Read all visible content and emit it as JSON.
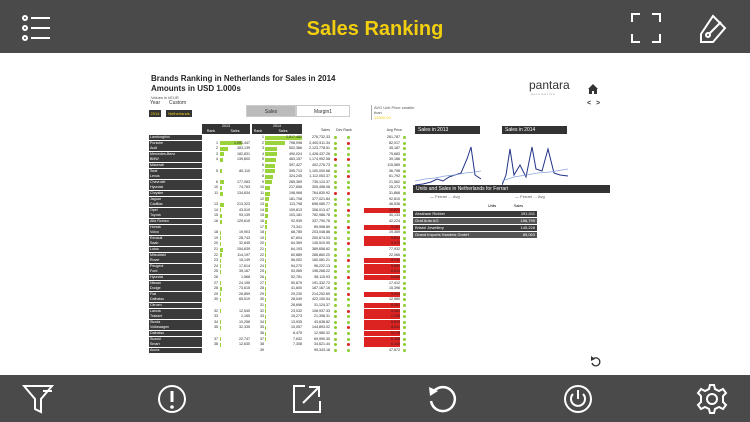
{
  "app": {
    "title": "Sales Ranking"
  },
  "toolbar": {
    "icons": [
      "list-icon",
      "fullscreen-icon",
      "tag-icon"
    ]
  },
  "bottom": {
    "icons": [
      "filter-icon",
      "alert-icon",
      "export-icon",
      "reload-icon",
      "power-icon",
      "settings-icon"
    ]
  },
  "report": {
    "title": "Brands Ranking in Netherlands for Sales in 2014",
    "subtitle": "Amounts in USD 1.000s",
    "note": "Values in kEUR",
    "logo": "pantara",
    "logo_sub": "automotive",
    "filter_year_label": "Year",
    "filter_year_value": "2014",
    "filter_custom_label": "Custom",
    "filter_custom_value": "Netherlands",
    "toggle_sales": "Sales",
    "toggle_margin": "Margin1",
    "filter_tag": "AVG Unit Price smaller than",
    "filter_tag_value": "13400.00",
    "nav_prev": "<",
    "nav_next": ">"
  },
  "table": {
    "group_2013": "2013",
    "group_2014": "2014",
    "col_rank": "Rank",
    "col_sales": "Sales",
    "col_sales_total": "Sales",
    "col_dev_rank": "Dev Rank",
    "col_avg_price": "Avg Price",
    "rows": [
      {
        "brand": "Lamborghini",
        "s13": "",
        "r13": "",
        "r14": "1",
        "s14": "1,517,482",
        "sales": "276,732.33",
        "avg": "261,787",
        "dot": "green",
        "b13": 0,
        "b14": 100,
        "red": 0
      },
      {
        "brand": "Porsche",
        "s13": "1,091,447",
        "r13": "1",
        "r14": "2",
        "s14": "798,098",
        "sales": "2,400,511.34",
        "avg": "82,017",
        "dot": "green",
        "b13": 72,
        "b14": 53,
        "red": 0
      },
      {
        "brand": "Audi",
        "s13": "383,139",
        "r13": "2",
        "r14": "3",
        "s14": "502,366",
        "sales": "2,123,778.51",
        "avg": "45,187",
        "dot": "green",
        "b13": 25,
        "b14": 33,
        "red": 0
      },
      {
        "brand": "Mercedes-Benz",
        "s13": "182,831",
        "r13": "3",
        "r14": "4",
        "s14": "490,024",
        "sales": "1,428,437.26",
        "avg": "75,683",
        "dot": "green",
        "b13": 12,
        "b14": 32,
        "red": 0
      },
      {
        "brand": "BMW",
        "s13": "139,800",
        "r13": "4",
        "r14": "5",
        "s14": "463,157",
        "sales": "1,174,992.58",
        "avg": "39,166",
        "dot": "red",
        "b13": 9,
        "b14": 30,
        "red": 0
      },
      {
        "brand": "Maserati",
        "s13": "",
        "r13": "",
        "r14": "6",
        "s14": "397,427",
        "sales": "402,276.73",
        "avg": "115,589",
        "dot": "green",
        "b13": 0,
        "b14": 26,
        "red": 0
      },
      {
        "brand": "Seat",
        "s13": "80,110",
        "r13": "5",
        "r14": "7",
        "s14": "395,713",
        "sales": "1,100,000.68",
        "avg": "36,798",
        "dot": "green",
        "b13": 5,
        "b14": 26,
        "red": 0
      },
      {
        "brand": "Lexus",
        "s13": "",
        "r13": "",
        "r14": "8",
        "s14": "324,245",
        "sales": "1,112,053.37",
        "avg": "61,792",
        "dot": "green",
        "b13": 0,
        "b14": 21,
        "red": 0
      },
      {
        "brand": "Chevrolet",
        "s13": "177,083",
        "r13": "6",
        "r14": "9",
        "s14": "285,369",
        "sales": "735,124.37",
        "avg": "21,562",
        "dot": "green",
        "b13": 12,
        "b14": 19,
        "red": 0
      },
      {
        "brand": "Hyundai",
        "s13": "74,763",
        "r13": "10",
        "r14": "10",
        "s14": "217,656",
        "sales": "305,498.08",
        "avg": "25,273",
        "dot": "green",
        "b13": 5,
        "b14": 14,
        "red": 0
      },
      {
        "brand": "Chrysler",
        "s13": "134,634",
        "r13": "11",
        "r14": "11",
        "s14": "198,968",
        "sales": "764,830.92",
        "avg": "31,868",
        "dot": "red",
        "b13": 9,
        "b14": 13,
        "red": 0
      },
      {
        "brand": "Jaguar",
        "s13": "",
        "r13": "",
        "r14": "12",
        "s14": "181,708",
        "sales": "377,021.84",
        "avg": "92,810",
        "dot": "green",
        "b13": 0,
        "b14": 12,
        "red": 0
      },
      {
        "brand": "Cadillac",
        "s13": "213,323",
        "r13": "13",
        "r14": "13",
        "s14": "113,798",
        "sales": "698,080.77",
        "avg": "46,536",
        "dot": "green",
        "b13": 14,
        "b14": 7,
        "red": 0
      },
      {
        "brand": "Opel",
        "s13": "43,519",
        "r13": "14",
        "r14": "14",
        "s14": "109,813",
        "sales": "308,013.47",
        "avg": "10,621",
        "dot": "green",
        "b13": 3,
        "b14": 7,
        "red": 100
      },
      {
        "brand": "Toyota",
        "s13": "93,139",
        "r13": "15",
        "r14": "15",
        "s14": "103,181",
        "sales": "782,986.78",
        "avg": "30,133",
        "dot": "green",
        "b13": 6,
        "b14": 7,
        "red": 0
      },
      {
        "brand": "Alfa Romeo",
        "s13": "129,615",
        "r13": "16",
        "r14": "16",
        "s14": "92,939",
        "sales": "337,790.76",
        "avg": "42,224",
        "dot": "green",
        "b13": 8,
        "b14": 6,
        "red": 0
      },
      {
        "brand": "Honda",
        "s13": "",
        "r13": "",
        "r14": "17",
        "s14": "73,341",
        "sales": "89,998.89",
        "avg": "9,103",
        "dot": "green",
        "b13": 0,
        "b14": 5,
        "red": 100
      },
      {
        "brand": "Volvo",
        "s13": "19,903",
        "r13": "18",
        "r14": "18",
        "s14": "68,785",
        "sales": "203,048.88",
        "avg": "19,369",
        "dot": "green",
        "b13": 1,
        "b14": 4,
        "red": 0
      },
      {
        "brand": "Renault",
        "s13": "28,743",
        "r13": "19",
        "r14": "19",
        "s14": "67,604",
        "sales": "250,674.03",
        "avg": "9,810",
        "dot": "green",
        "b13": 2,
        "b14": 4,
        "red": 100
      },
      {
        "brand": "Saab",
        "s13": "32,845",
        "r13": "20",
        "r14": "20",
        "s14": "64,369",
        "sales": "145,510.90",
        "avg": "9,070",
        "dot": "green",
        "b13": 2,
        "b14": 4,
        "red": 100
      },
      {
        "brand": "Lotus",
        "s13": "154,639",
        "r13": "21",
        "r14": "21",
        "s14": "64,193",
        "sales": "389,658.62",
        "avg": "77,932",
        "dot": "green",
        "b13": 10,
        "b14": 4,
        "red": 0
      },
      {
        "brand": "Mitsubishi",
        "s13": "114,197",
        "r13": "22",
        "r14": "22",
        "s14": "60,889",
        "sales": "286,860.20",
        "avg": "22,066",
        "dot": "green",
        "b13": 7,
        "b14": 4,
        "red": 0
      },
      {
        "brand": "Rover",
        "s13": "15,149",
        "r13": "23",
        "r14": "23",
        "s14": "56,002",
        "sales": "160,081.21",
        "avg": "8,211",
        "dot": "green",
        "b13": 1,
        "b14": 4,
        "red": 100
      },
      {
        "brand": "Peugeot",
        "s13": "17,614",
        "r13": "24",
        "r14": "24",
        "s14": "54,270",
        "sales": "96,222.13",
        "avg": "9,662",
        "dot": "green",
        "b13": 1,
        "b14": 3,
        "red": 100
      },
      {
        "brand": "Ford",
        "s13": "35,167",
        "r13": "25",
        "r14": "25",
        "s14": "53,065",
        "sales": "196,268.22",
        "avg": "8,514",
        "dot": "green",
        "b13": 2,
        "b14": 3,
        "red": 100
      },
      {
        "brand": "Hyundai",
        "s13": "1,568",
        "r13": "26",
        "r14": "26",
        "s14": "52,781",
        "sales": "58,115.93",
        "avg": "6,843",
        "dot": "green",
        "b13": 0,
        "b14": 3,
        "red": 100
      },
      {
        "brand": "Nissan",
        "s13": "24,195",
        "r13": "27",
        "r14": "27",
        "s14": "50,679",
        "sales": "191,332.72",
        "avg": "17,412",
        "dot": "green",
        "b13": 2,
        "b14": 3,
        "red": 0
      },
      {
        "brand": "Dodge",
        "s13": "73,615",
        "r13": "28",
        "r14": "28",
        "s14": "41,600",
        "sales": "187,167.16",
        "avg": "15,396",
        "dot": "green",
        "b13": 5,
        "b14": 3,
        "red": 0
      },
      {
        "brand": "Fiat",
        "s13": "26,859",
        "r13": "29",
        "r14": "29",
        "s14": "29,230",
        "sales": "214,252.69",
        "avg": "9,244",
        "dot": "green",
        "b13": 2,
        "b14": 2,
        "red": 100
      },
      {
        "brand": "Daihatsu",
        "s13": "65,519",
        "r13": "30",
        "r14": "30",
        "s14": "28,049",
        "sales": "422,150.54",
        "avg": "12,960",
        "dot": "green",
        "b13": 4,
        "b14": 2,
        "red": 0
      },
      {
        "brand": "Citroen",
        "s13": "",
        "r13": "",
        "r14": "31",
        "s14": "26,696",
        "sales": "31,124.37",
        "avg": "8,391",
        "dot": "green",
        "b13": 0,
        "b14": 2,
        "red": 100
      },
      {
        "brand": "Lancia",
        "s13": "12,540",
        "r13": "32",
        "r14": "32",
        "s14": "23,032",
        "sales": "108,937.33",
        "avg": "9,062",
        "dot": "green",
        "b13": 1,
        "b14": 2,
        "red": 100
      },
      {
        "brand": "Trabant",
        "s13": "1,165",
        "r13": "33",
        "r14": "33",
        "s14": "15,273",
        "sales": "21,398.31",
        "avg": "2,139",
        "dot": "green",
        "b13": 0,
        "b14": 1,
        "red": 100
      },
      {
        "brand": "Skoda",
        "s13": "10,256",
        "r13": "34",
        "r14": "34",
        "s14": "13,935",
        "sales": "43,638.82",
        "avg": "6,519",
        "dot": "green",
        "b13": 1,
        "b14": 1,
        "red": 100
      },
      {
        "brand": "Volkswagen",
        "s13": "32,335",
        "r13": "35",
        "r14": "35",
        "s14": "10,057",
        "sales": "144,893.02",
        "avg": "8,611",
        "dot": "green",
        "b13": 2,
        "b14": 1,
        "red": 100
      },
      {
        "brand": "Daihatsu",
        "s13": "",
        "r13": "",
        "r14": "36",
        "s14": "8,475",
        "sales": "12,980.32",
        "avg": "5,178",
        "dot": "green",
        "b13": 0,
        "b14": 1,
        "red": 100
      },
      {
        "brand": "Suzuki",
        "s13": "22,747",
        "r13": "37",
        "r14": "37",
        "s14": "7,632",
        "sales": "69,990.30",
        "avg": "6,308",
        "dot": "green",
        "b13": 2,
        "b14": 1,
        "red": 100
      },
      {
        "brand": "Smart",
        "s13": "12,630",
        "r13": "38",
        "r14": "38",
        "s14": "7,308",
        "sales": "34,621.44",
        "avg": "6,105",
        "dot": "green",
        "b13": 1,
        "b14": 0,
        "red": 100
      },
      {
        "brand": "Acura",
        "s13": "",
        "r13": "",
        "r14": "39",
        "s14": "",
        "sales": "95,343.18",
        "avg": "47,672",
        "dot": "green",
        "b13": 0,
        "b14": 0,
        "red": 0
      }
    ]
  },
  "sparks": {
    "title_2013": "Sales in 2013",
    "title_2014": "Sales in 2014",
    "legend_ferrari": "Ferrari",
    "legend_avg": "Avg"
  },
  "ferrari": {
    "title": "Units and Sales in Netherlands for Ferrari",
    "col_units": "Units",
    "col_sales": "Sales",
    "rows": [
      {
        "name": "Abraham Richter",
        "units": "",
        "sales": "191,011"
      },
      {
        "name": "Graf Auto AG",
        "units": "",
        "sales": "156,799"
      },
      {
        "name": "Bristol Jewellery",
        "units": "",
        "sales": "145,228"
      },
      {
        "name": "Grand Imports Handels GmbH",
        "units": "",
        "sales": "85,063"
      }
    ]
  }
}
